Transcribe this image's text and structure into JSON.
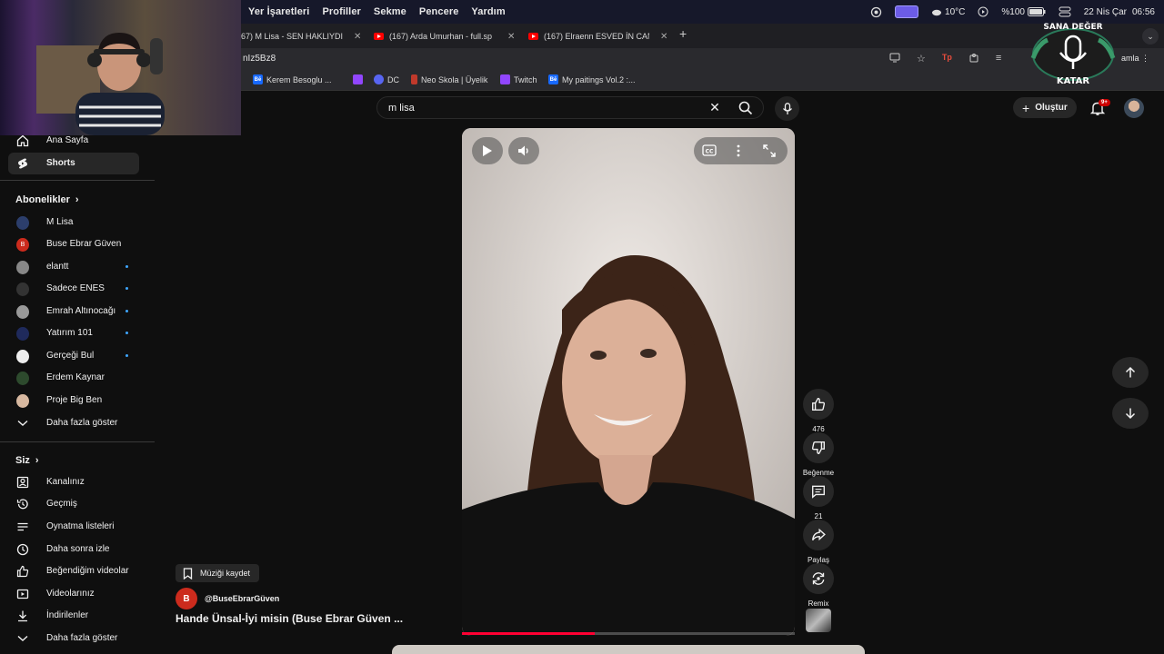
{
  "menubar": {
    "items": [
      "Yer İşaretleri",
      "Profiller",
      "Sekme",
      "Pencere",
      "Yardım"
    ],
    "weather": "10°C",
    "battery": "%100",
    "date": "22 Nis Çar",
    "time": "06:56"
  },
  "tabs": [
    {
      "title": "67) M Lisa - SEN HAKLIYDI"
    },
    {
      "title": "(167) Arda Umurhan - full.sp"
    },
    {
      "title": "(167) Elraenn ESVED İN CAN"
    }
  ],
  "omnibox": {
    "url": "nIz5Bz8",
    "continue_label": "amla"
  },
  "bookmarks": [
    {
      "label": "Kerem Besoglu  ...",
      "icon": "behance-icon",
      "color": "#1769ff"
    },
    {
      "label": "",
      "icon": "twitch-icon",
      "color": "#9146ff"
    },
    {
      "label": "DC",
      "icon": "discord-icon",
      "color": "#5865f2"
    },
    {
      "label": "Neo Skola | Üyelik",
      "icon": "bookmark-icon",
      "color": "#c0392b"
    },
    {
      "label": "Twitch",
      "icon": "twitch-icon",
      "color": "#9146ff"
    },
    {
      "label": "My paitings Vol.2 :...",
      "icon": "behance-icon",
      "color": "#1769ff"
    }
  ],
  "header": {
    "search_query": "m lisa",
    "create_label": "Oluştur",
    "notifications": "9+"
  },
  "sidebar": {
    "home": "Ana Sayfa",
    "shorts": "Shorts",
    "subscriptions_title": "Abonelikler",
    "subscriptions": [
      {
        "name": "M Lisa",
        "dot": false,
        "color": "#2c3e6b"
      },
      {
        "name": "Buse Ebrar Güven",
        "dot": false,
        "color": "#cc2b1d",
        "initial": "B"
      },
      {
        "name": "elantt",
        "dot": true,
        "color": "#888888"
      },
      {
        "name": "Sadece ENES",
        "dot": true,
        "color": "#333333"
      },
      {
        "name": "Emrah Altınocağı",
        "dot": true,
        "color": "#999999"
      },
      {
        "name": "Yatırım 101",
        "dot": true,
        "color": "#1f2a5c"
      },
      {
        "name": "Gerçeği Bul",
        "dot": true,
        "color": "#eeeeee"
      },
      {
        "name": "Erdem Kaynar",
        "dot": false,
        "color": "#2d4a2d"
      },
      {
        "name": "Proje Big Ben",
        "dot": false,
        "color": "#d7b8a0"
      }
    ],
    "show_more": "Daha fazla göster",
    "you_title": "Siz",
    "you_items": [
      {
        "label": "Kanalınız",
        "icon": "channel-icon"
      },
      {
        "label": "Geçmiş",
        "icon": "history-icon"
      },
      {
        "label": "Oynatma listeleri",
        "icon": "playlist-icon"
      },
      {
        "label": "Daha sonra izle",
        "icon": "clock-icon"
      },
      {
        "label": "Beğendiğim videolar",
        "icon": "thumb-up-icon"
      },
      {
        "label": "Videolarınız",
        "icon": "video-icon"
      },
      {
        "label": "İndirilenler",
        "icon": "download-icon"
      }
    ],
    "show_more_2": "Daha fazla göster"
  },
  "short": {
    "save_music": "Müziği kaydet",
    "channel_initial": "B",
    "channel_name": "@BuseEbrarGüven",
    "title": "Hande Ünsal-İyi misin (Buse Ebrar Güven ...",
    "progress": 0.4
  },
  "actions": {
    "likes": "476",
    "dislike": "Beğenme",
    "comments": "21",
    "share": "Paylaş",
    "remix": "Remix"
  },
  "overlay_logo": {
    "text_top": "SANA DEĞER",
    "text_bottom": "KATAR"
  }
}
